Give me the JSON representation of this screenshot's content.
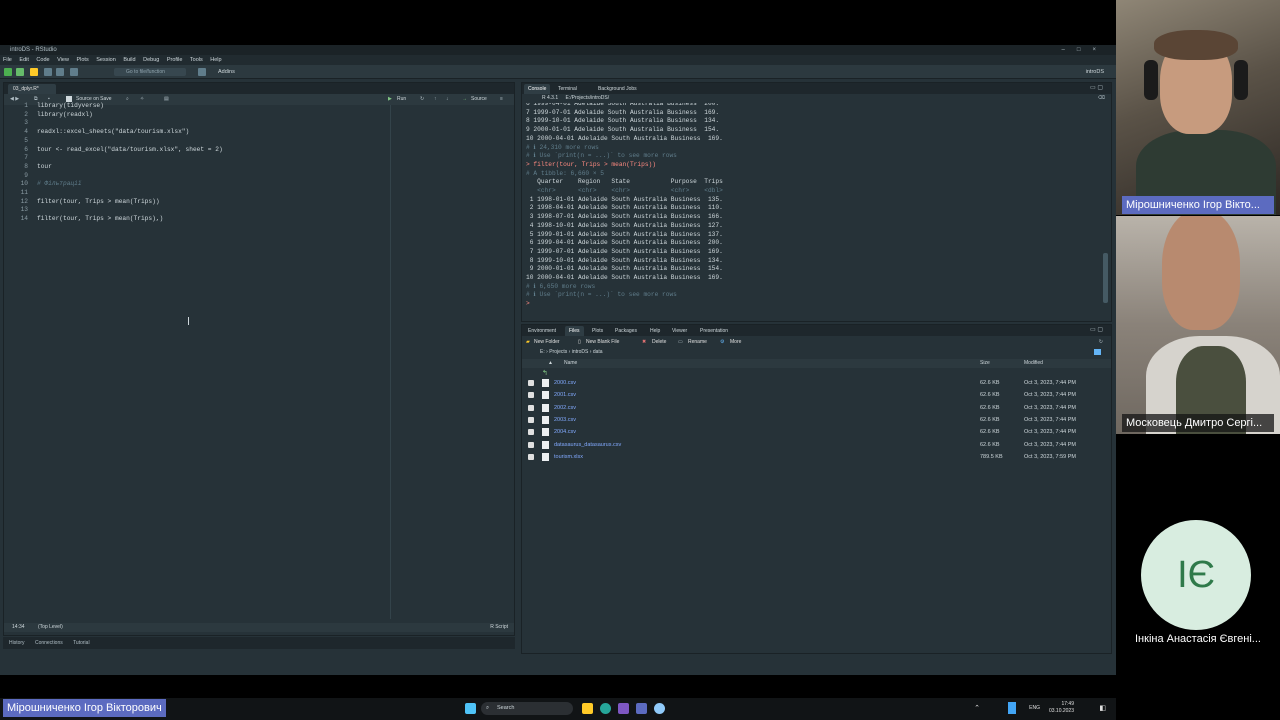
{
  "window": {
    "title": "introDS - RStudio",
    "controls": [
      "–",
      "□",
      "×"
    ]
  },
  "menu": [
    "File",
    "Edit",
    "Code",
    "View",
    "Plots",
    "Session",
    "Build",
    "Debug",
    "Profile",
    "Tools",
    "Help"
  ],
  "toolbar": {
    "goto_placeholder": "Go to file/function",
    "addins_label": "Addins",
    "project_label": "introDS"
  },
  "source": {
    "tab_label": "03_dplyr.R*",
    "source_on_save": "Source on Save",
    "run_label": "Run",
    "source_label": "Source",
    "lines": [
      {
        "n": "1",
        "text": "library(tidyverse)"
      },
      {
        "n": "2",
        "text": "library(readxl)"
      },
      {
        "n": "3",
        "text": ""
      },
      {
        "n": "4",
        "text": "readxl::excel_sheets(\"data/tourism.xlsx\")"
      },
      {
        "n": "5",
        "text": ""
      },
      {
        "n": "6",
        "text": "tour <- read_excel(\"data/tourism.xlsx\", sheet = 2)"
      },
      {
        "n": "7",
        "text": ""
      },
      {
        "n": "8",
        "text": "tour"
      },
      {
        "n": "9",
        "text": ""
      },
      {
        "n": "10",
        "text": "# Фільтрації"
      },
      {
        "n": "11",
        "text": ""
      },
      {
        "n": "12",
        "text": "filter(tour, Trips > mean(Trips))"
      },
      {
        "n": "13",
        "text": ""
      },
      {
        "n": "14",
        "text": "filter(tour, Trips > mean(Trips),)"
      }
    ],
    "status_position": "14:34",
    "status_scope": "(Top Level)",
    "status_type": "R Script"
  },
  "bottom_left_tabs": [
    "History",
    "Connections",
    "Tutorial"
  ],
  "console": {
    "tabs": [
      "Console",
      "Terminal",
      "Background Jobs"
    ],
    "version": "R 4.3.1",
    "path": "E:/Projects/introDS/",
    "lines": [
      {
        "t": "6 1999-04-01 Adelaide South Australia Business  200.",
        "k": ""
      },
      {
        "t": "7 1999-07-01 Adelaide South Australia Business  169.",
        "k": ""
      },
      {
        "t": "8 1999-10-01 Adelaide South Australia Business  134.",
        "k": ""
      },
      {
        "t": "9 2000-01-01 Adelaide South Australia Business  154.",
        "k": ""
      },
      {
        "t": "10 2000-04-01 Adelaide South Australia Business  169.",
        "k": ""
      },
      {
        "t": "# ℹ 24,310 more rows",
        "k": "dim"
      },
      {
        "t": "# ℹ Use `print(n = ...)` to see more rows",
        "k": "dim"
      },
      {
        "t": "> filter(tour, Trips > mean(Trips))",
        "k": "cmd"
      },
      {
        "t": "# A tibble: 6,660 × 5",
        "k": "dim"
      },
      {
        "t": "   Quarter    Region   State           Purpose  Trips",
        "k": ""
      },
      {
        "t": "   <chr>      <chr>    <chr>           <chr>    <dbl>",
        "k": "dim"
      },
      {
        "t": " 1 1998-01-01 Adelaide South Australia Business  135.",
        "k": ""
      },
      {
        "t": " 2 1998-04-01 Adelaide South Australia Business  110.",
        "k": ""
      },
      {
        "t": " 3 1998-07-01 Adelaide South Australia Business  166.",
        "k": ""
      },
      {
        "t": " 4 1998-10-01 Adelaide South Australia Business  127.",
        "k": ""
      },
      {
        "t": " 5 1999-01-01 Adelaide South Australia Business  137.",
        "k": ""
      },
      {
        "t": " 6 1999-04-01 Adelaide South Australia Business  200.",
        "k": ""
      },
      {
        "t": " 7 1999-07-01 Adelaide South Australia Business  169.",
        "k": ""
      },
      {
        "t": " 8 1999-10-01 Adelaide South Australia Business  134.",
        "k": ""
      },
      {
        "t": " 9 2000-01-01 Adelaide South Australia Business  154.",
        "k": ""
      },
      {
        "t": "10 2000-04-01 Adelaide South Australia Business  169.",
        "k": ""
      },
      {
        "t": "# ℹ 6,650 more rows",
        "k": "dim"
      },
      {
        "t": "# ℹ Use `print(n = ...)` to see more rows",
        "k": "dim"
      },
      {
        "t": ">",
        "k": "cmd"
      }
    ]
  },
  "files": {
    "tabs": [
      "Environment",
      "Files",
      "Plots",
      "Packages",
      "Help",
      "Viewer",
      "Presentation"
    ],
    "toolbar": [
      "New Folder",
      "New Blank File",
      "Delete",
      "Rename",
      "More"
    ],
    "crumbs": [
      "E:",
      "Projects",
      "introDS",
      "data"
    ],
    "header_name": "Name",
    "header_size": "Size",
    "header_modified": "Modified",
    "rows": [
      {
        "name": "2000.csv",
        "size": "62.6 KB",
        "modified": "Oct 3, 2023, 7:44 PM"
      },
      {
        "name": "2001.csv",
        "size": "62.6 KB",
        "modified": "Oct 3, 2023, 7:44 PM"
      },
      {
        "name": "2002.csv",
        "size": "62.6 KB",
        "modified": "Oct 3, 2023, 7:44 PM"
      },
      {
        "name": "2003.csv",
        "size": "62.6 KB",
        "modified": "Oct 3, 2023, 7:44 PM"
      },
      {
        "name": "2004.csv",
        "size": "62.6 KB",
        "modified": "Oct 3, 2023, 7:44 PM"
      },
      {
        "name": "datasaurus_datasaurus.csv",
        "size": "62.6 KB",
        "modified": "Oct 3, 2023, 7:44 PM"
      },
      {
        "name": "tourism.xlsx",
        "size": "789.5 KB",
        "modified": "Oct 3, 2023, 7:59 PM"
      }
    ]
  },
  "taskbar": {
    "search_label": "Search",
    "lang": "ENG",
    "time": "17:49",
    "date": "03.10.2023"
  },
  "participants": [
    {
      "name": "Мірошниченко Ігор Вікто..."
    },
    {
      "name": "Московець Дмитро Сергі..."
    },
    {
      "name": "Інкіна Анастасія Євгені...",
      "initials": "ІЄ"
    }
  ],
  "speaker_name": "Мірошниченко Ігор Вікторович"
}
